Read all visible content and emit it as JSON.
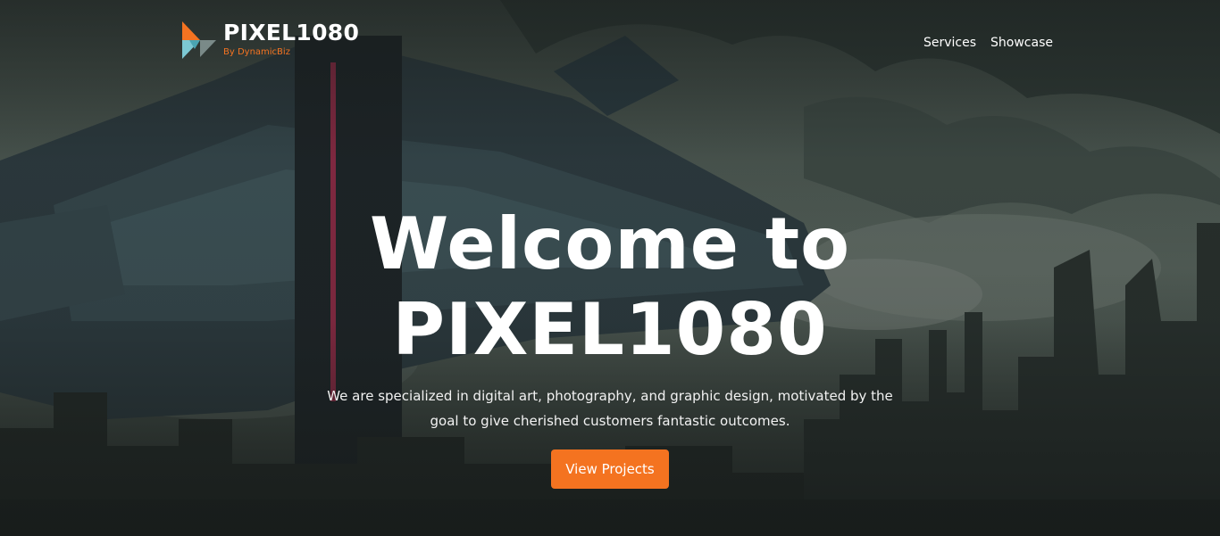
{
  "brand": {
    "name": "PIXEL1080",
    "byline": "By DynamicBiz",
    "accent_color": "#f47321",
    "logo_icon": "play-triangle-logo-icon"
  },
  "nav": {
    "items": [
      {
        "label": "Services"
      },
      {
        "label": "Showcase"
      }
    ]
  },
  "hero": {
    "title_line1": "Welcome to",
    "title_line2": "PIXEL1080",
    "tagline": "We are specialized in digital art, photography, and graphic design, motivated by the goal to give cherished customers fantastic outcomes.",
    "cta_label": "View Projects",
    "background": "sci-fi city artwork"
  }
}
